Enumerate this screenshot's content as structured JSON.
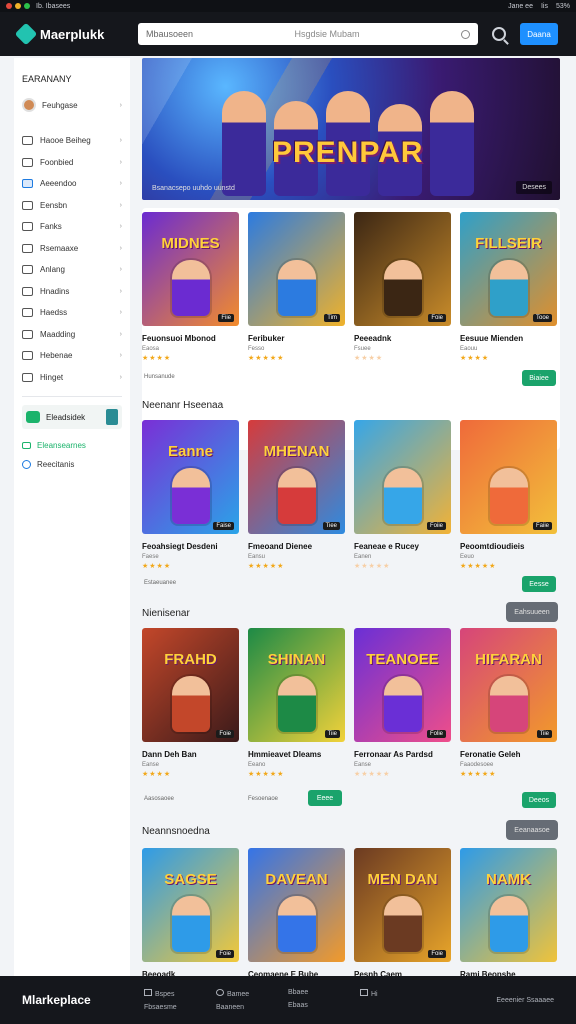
{
  "statusbar": {
    "left_text": "Ib. Ibasees",
    "right_items": [
      "Jane ee",
      "Iis",
      "53%"
    ]
  },
  "header": {
    "app_name": "Maerplukk",
    "search_placeholder": "Mbausoeen",
    "search_hint": "Hsgdsie Mubam",
    "cta_label": "Daana"
  },
  "sidebar": {
    "title": "EARANANY",
    "profile_name": "Feuhgase",
    "items": [
      {
        "label": "Haooe Beiheg",
        "icon": "box-icon"
      },
      {
        "label": "Foonbied",
        "icon": "box-icon"
      },
      {
        "label": "Aeeendoo",
        "icon": "box-icon"
      },
      {
        "label": "Eensbn",
        "icon": "box-icon"
      },
      {
        "label": "Fanks",
        "icon": "box-icon"
      },
      {
        "label": "Rsemaaxe",
        "icon": "box-icon"
      },
      {
        "label": "Anlang",
        "icon": "box-icon"
      },
      {
        "label": "Hnadins",
        "icon": "box-icon"
      },
      {
        "label": "Haedss",
        "icon": "box-icon"
      },
      {
        "label": "Maadding",
        "icon": "box-icon"
      },
      {
        "label": "Hebenae",
        "icon": "box-icon"
      },
      {
        "label": "Hinget",
        "icon": "box-icon"
      }
    ],
    "promo_label": "Eleadsidek",
    "sub_active": "Eleansearnes",
    "sub_other": "Reecitanis"
  },
  "hero": {
    "title": "PRENPAR",
    "caption": "Bsanacsepo uuhdo uunstd",
    "button": "Desees"
  },
  "sections": [
    {
      "title": "",
      "footnote": "Hunsanude",
      "button": "Biaiee",
      "cards": [
        {
          "art": "MIDNES",
          "name": "Feuonsuoi Mbonod",
          "sub": "Eaosa",
          "stars": "★★★★",
          "tag": "Fiie",
          "palette": [
            "#6b2bd1",
            "#f38c2c"
          ]
        },
        {
          "art": "",
          "name": "Feribuker",
          "sub": "Fesso",
          "stars": "★★★★★",
          "tag": "Tim",
          "palette": [
            "#2c7be0",
            "#f0b22a"
          ]
        },
        {
          "art": "",
          "name": "Peeeadnk",
          "sub": "Fsuee",
          "stars": "★★★★",
          "tag": "Foie",
          "palette": [
            "#3b2614",
            "#c98c2a"
          ]
        },
        {
          "art": "FILLSEIR",
          "name": "Eesuue Mienden",
          "sub": "Eaouu",
          "stars": "★★★★",
          "tag": "Tooe",
          "palette": [
            "#2fa0c9",
            "#e08f2c"
          ]
        }
      ]
    },
    {
      "title": "Neenanr Hseenaa",
      "footnote": "Estaeuanee",
      "button": "Eesse",
      "cards": [
        {
          "art": "Eanne",
          "name": "Feoahsiegt Desdeni",
          "sub": "Faese",
          "stars": "★★★★",
          "tag": "Faise",
          "palette": [
            "#7a2fd6",
            "#2aa4e8"
          ]
        },
        {
          "art": "MHENAN",
          "name": "Fmeoand Dienee",
          "sub": "Eansu",
          "stars": "★★★★★",
          "tag": "Tiee",
          "palette": [
            "#d63b3b",
            "#2e8be0"
          ]
        },
        {
          "art": "",
          "name": "Feaneae e Rucey",
          "sub": "Eanen",
          "stars": "★★★★★",
          "tag": "Foiie",
          "palette": [
            "#36a6e8",
            "#f2b236"
          ]
        },
        {
          "art": "",
          "name": "Peoomtdioudieis",
          "sub": "Eeuo",
          "stars": "★★★★★",
          "tag": "Faiie",
          "palette": [
            "#ef6a3a",
            "#f2c03a"
          ]
        }
      ]
    },
    {
      "title": "Nienisenar",
      "side_button": "Eahsuueen",
      "footnote": "Aasosaoee",
      "footnote2": "Fesoenaoe",
      "button": "Deeos",
      "button2": "Eeee",
      "cards": [
        {
          "art": "FRAHD",
          "name": "Dann Deh Ban",
          "sub": "Eanse",
          "stars": "★★★★",
          "tag": "Foie",
          "palette": [
            "#c3472a",
            "#3a1a1a"
          ]
        },
        {
          "art": "SHINAN",
          "name": "Hmmieavet Dleams",
          "sub": "Eeano",
          "stars": "★★★★★",
          "tag": "Tiie",
          "palette": [
            "#1d8a46",
            "#f2d23a"
          ]
        },
        {
          "art": "TEANOEE",
          "name": "Ferronaar As Pardsd",
          "sub": "Eanse",
          "stars": "★★★★★",
          "tag": "Folie",
          "palette": [
            "#6a2fd6",
            "#ef4e8a"
          ]
        },
        {
          "art": "HIFARAN",
          "name": "Feronatie Geleh",
          "sub": "Faaodesoee",
          "stars": "★★★★★",
          "tag": "Tiie",
          "palette": [
            "#d6457a",
            "#f29a2a"
          ]
        }
      ]
    },
    {
      "title": "Neannsnoedna",
      "side_button": "Eeanaasoe",
      "cards": [
        {
          "art": "SAGSE",
          "name": "Beeoadk",
          "sub": "",
          "stars": "",
          "tag": "Foie",
          "palette": [
            "#2e9be8",
            "#f2c83a"
          ]
        },
        {
          "art": "DAVEAN",
          "name": "Ceomaene E Bube",
          "sub": "",
          "stars": "",
          "tag": "",
          "palette": [
            "#3474e8",
            "#f29a2a"
          ]
        },
        {
          "art": "MEN DAN",
          "name": "Pesnh Caem",
          "sub": "",
          "stars": "",
          "tag": "Foie",
          "palette": [
            "#6b3a22",
            "#e8a52a"
          ]
        },
        {
          "art": "NAMK",
          "name": "Rami Beonshe",
          "sub": "",
          "stars": "",
          "tag": "",
          "palette": [
            "#2e9be8",
            "#f0c33a"
          ]
        }
      ]
    }
  ],
  "bottombar": {
    "brand": "Mlarkeplace",
    "items": [
      {
        "top": "Bspes",
        "bottom": "Fbsaesme"
      },
      {
        "top": "Bamee",
        "bottom": "Baaneen"
      },
      {
        "top": "Bbaee",
        "bottom": "Ebaas"
      },
      {
        "top": "Hi",
        "bottom": ""
      }
    ],
    "right_top": "Eeeenier Ssaaaee",
    "right_bottom": ""
  }
}
